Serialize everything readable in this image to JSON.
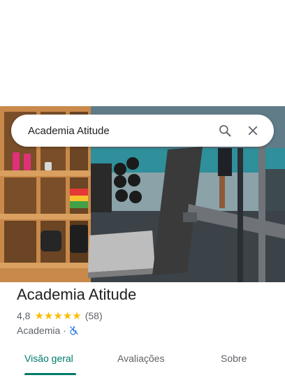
{
  "search": {
    "query": "Academia Atitude"
  },
  "place": {
    "name": "Academia Atitude",
    "rating": "4,8",
    "stars": 5,
    "review_count": "(58)",
    "category": "Academia",
    "separator": "·"
  },
  "icons": {
    "search": "search-icon",
    "close": "close-icon",
    "accessibility": "wheelchair-unavailable-icon"
  },
  "tabs": [
    {
      "label": "Visão geral",
      "active": true
    },
    {
      "label": "Avaliações",
      "active": false
    },
    {
      "label": "Sobre",
      "active": false
    }
  ],
  "colors": {
    "accent": "#00796b",
    "star": "#fbbc04",
    "accessibility_icon": "#1a73e8"
  }
}
